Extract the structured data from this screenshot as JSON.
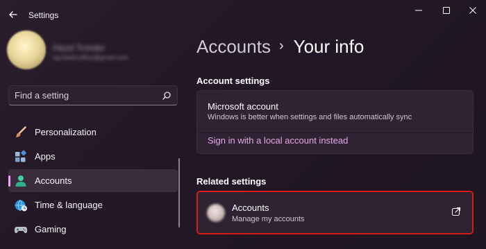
{
  "window": {
    "app_title": "Settings",
    "controls": [
      "minimize-icon",
      "maximize-icon",
      "close-icon"
    ]
  },
  "profile": {
    "name": "Hazel Tronder",
    "email": "raj.thedrzoffice@gmail.com"
  },
  "search": {
    "placeholder": "Find a setting",
    "icon": "search-icon"
  },
  "nav": {
    "items": [
      {
        "label": "Personalization",
        "icon": "brush-icon",
        "selected": false
      },
      {
        "label": "Apps",
        "icon": "apps-icon",
        "selected": false
      },
      {
        "label": "Accounts",
        "icon": "person-icon",
        "selected": true
      },
      {
        "label": "Time & language",
        "icon": "globe-clock-icon",
        "selected": false
      },
      {
        "label": "Gaming",
        "icon": "gamepad-icon",
        "selected": false
      }
    ]
  },
  "breadcrumb": {
    "parent": "Accounts",
    "separator": "›",
    "current": "Your info"
  },
  "account_settings": {
    "title": "Account settings",
    "card": {
      "title": "Microsoft account",
      "subtitle": "Windows is better when settings and files automatically sync",
      "link": "Sign in with a local account instead"
    }
  },
  "related_settings": {
    "title": "Related settings",
    "card": {
      "title": "Accounts",
      "subtitle": "Manage my accounts",
      "icon": "open-external-icon"
    }
  },
  "colors": {
    "accent": "#e6a8e6",
    "selection_indicator": "#f2a7f0",
    "highlight_border": "#d71a1a",
    "background": "#231826"
  }
}
